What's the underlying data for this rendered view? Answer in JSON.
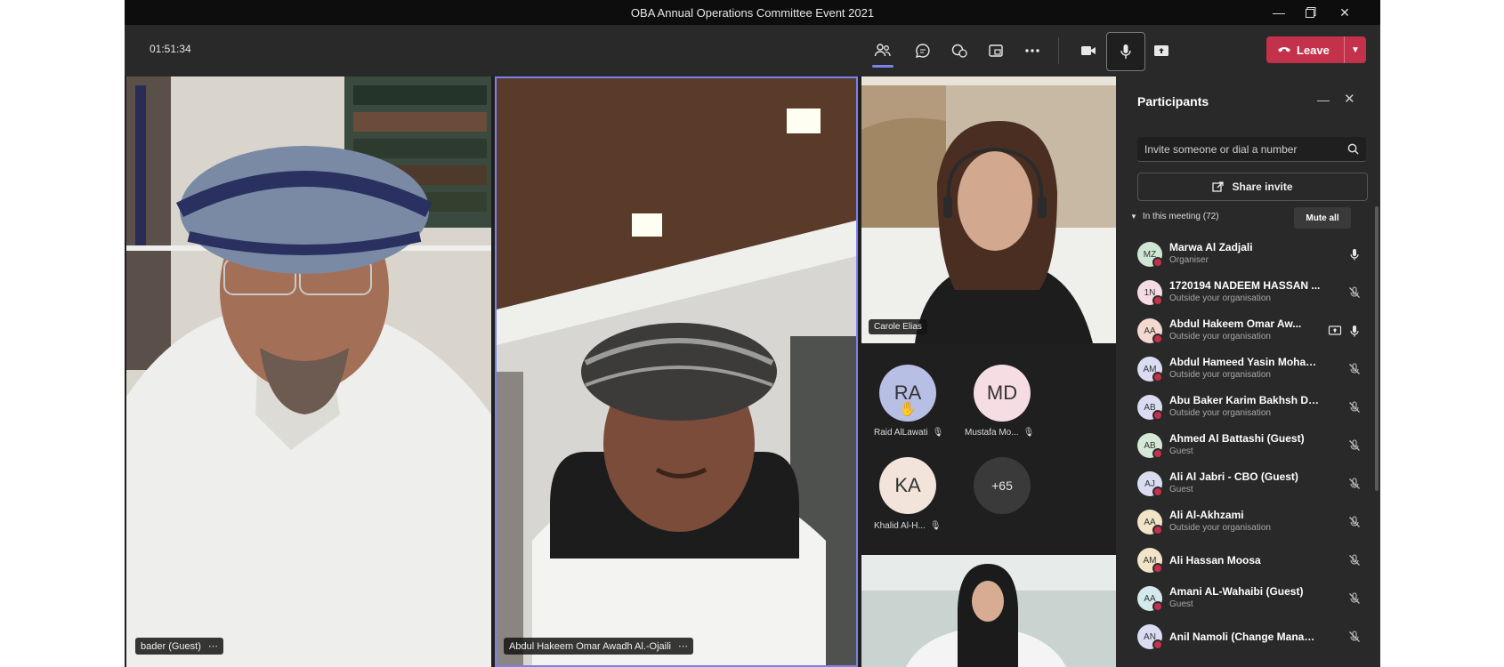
{
  "window": {
    "title": "OBA Annual Operations Committee Event 2021"
  },
  "toolbar": {
    "timer": "01:51:34",
    "leave_label": "Leave"
  },
  "colors": {
    "accent": "#7b83eb",
    "leave": "#c4314b",
    "panel": "#292929",
    "stage": "#1f1f1f"
  },
  "stage": {
    "tile1_name": "bader (Guest)",
    "tile2_name": "Abdul Hakeem Omar Awadh Al.-Ojaili",
    "tile3_name": "Carole Elias",
    "avatars": [
      {
        "initials": "RA",
        "label": "Raid AlLawati",
        "color": "#b7bfe4"
      },
      {
        "initials": "MD",
        "label": "Mustafa Mo...",
        "color": "#f6dde4"
      },
      {
        "initials": "KA",
        "label": "Khalid Al-H...",
        "color": "#f2e4da"
      }
    ],
    "overflow": "+65"
  },
  "panel": {
    "title": "Participants",
    "invite_placeholder": "Invite someone or dial a number",
    "share_invite": "Share invite",
    "section_label": "In this meeting (72)",
    "mute_all": "Mute all",
    "participants": [
      {
        "initials": "MZ",
        "name": "Marwa Al Zadjali",
        "sub": "Organiser",
        "color": "#cfe6d5",
        "mic": "on"
      },
      {
        "initials": "1N",
        "name": "1720194 NADEEM HASSAN ...",
        "sub": "Outside your organisation",
        "color": "#f4dbe4",
        "mic": "off"
      },
      {
        "initials": "AA",
        "name": "Abdul Hakeem Omar Aw...",
        "sub": "Outside your organisation",
        "color": "#f3d9cf",
        "mic": "on",
        "share": true
      },
      {
        "initials": "AM",
        "name": "Abdul Hameed Yasin Moham...",
        "sub": "Outside your organisation",
        "color": "#dadcf2",
        "mic": "off"
      },
      {
        "initials": "AB",
        "name": "Abu Baker Karim Bakhsh Dad ...",
        "sub": "Outside your organisation",
        "color": "#dadcf2",
        "mic": "off"
      },
      {
        "initials": "AB",
        "name": "Ahmed Al Battashi (Guest)",
        "sub": "Guest",
        "color": "#d5e8d8",
        "mic": "off"
      },
      {
        "initials": "AJ",
        "name": "Ali Al Jabri - CBO (Guest)",
        "sub": "Guest",
        "color": "#dadcf2",
        "mic": "off"
      },
      {
        "initials": "AA",
        "name": "Ali Al-Akhzami",
        "sub": "Outside your organisation",
        "color": "#f1e4c8",
        "mic": "off"
      },
      {
        "initials": "AM",
        "name": "Ali Hassan Moosa",
        "sub": "",
        "color": "#f1e4c8",
        "mic": "off"
      },
      {
        "initials": "AA",
        "name": "Amani AL-Wahaibi (Guest)",
        "sub": "Guest",
        "color": "#d4e9ec",
        "mic": "off"
      },
      {
        "initials": "AN",
        "name": "Anil Namoli (Change Manage...",
        "sub": "",
        "color": "#dadcf2",
        "mic": "off"
      }
    ]
  }
}
